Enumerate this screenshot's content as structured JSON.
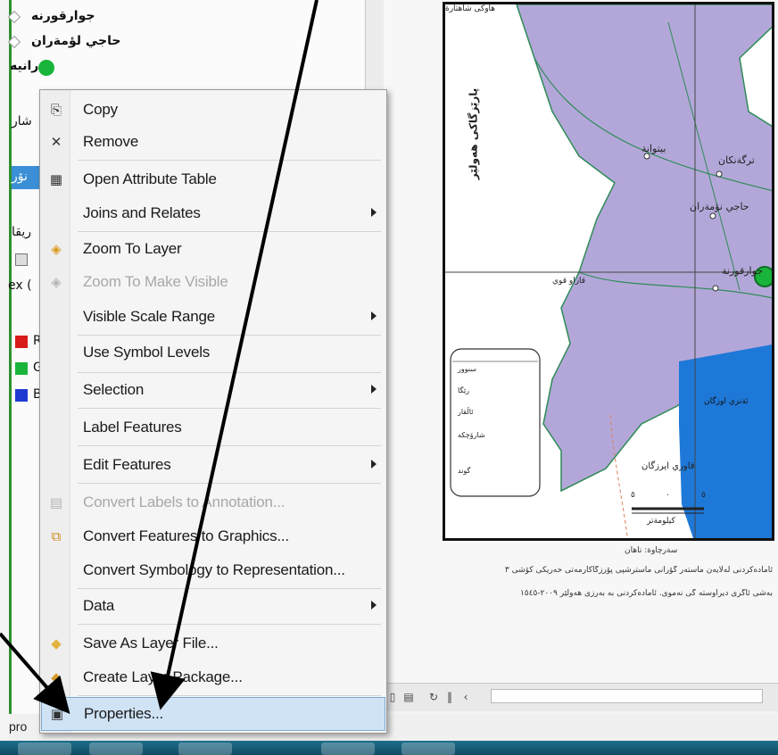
{
  "toc": {
    "layers": [
      {
        "label": "جوارقورنه"
      },
      {
        "label": "حاجي لؤمةران"
      },
      {
        "label": "رانيه"
      }
    ],
    "partial_labels": [
      "شار",
      "نۆر",
      "ريقا",
      "ex (",
      "R",
      "G",
      "B"
    ],
    "band_colors": {
      "R": "#d81b1b",
      "G": "#19b43a",
      "B": "#1f3ad0"
    },
    "highlight_color": "#3b8fd6"
  },
  "map": {
    "polygon_color": "#b3a7d9",
    "water_color": "#1e78d8",
    "place_labels": [
      {
        "text": "بيتوانة"
      },
      {
        "text": "ترگةنكان"
      },
      {
        "text": "حاجي نؤمةران"
      },
      {
        "text": "جوارقورنة"
      },
      {
        "text": "قازاو قوي"
      },
      {
        "text": "ئةنزي اوزگان"
      },
      {
        "text": "قاوري ايرزگان"
      }
    ],
    "vertical_title": "پارێزگاکی هەولێر",
    "top_label": "هاوکی شاهتارة",
    "scale_values": [
      "٥",
      "٠",
      "٥"
    ],
    "scale_unit": "كيلومةتر",
    "legend_items": [
      "سنوور",
      "رێگا",
      "ئاڵقار",
      "شارۆچکە",
      "گوند"
    ],
    "notes": [
      "سةرچاوة: تاهان",
      "ئامادەکردنی لەلایەن ماستەر گۆرانی ماسترشپی پۆرزگاکارمەتی خەریکی کۆشی ١٥٣ -",
      "بەشی ئاگری دیراوستە گی نەموی. ئامادەکردنی بە بەرزی هەولێر ٢٠٠٩-١٥٤٥ "
    ]
  },
  "context_menu": {
    "items": [
      {
        "label": "Copy",
        "icon": "copy-icon",
        "glyph": "⎘",
        "submenu": false,
        "disabled": false
      },
      {
        "label": "Remove",
        "icon": "remove-icon",
        "glyph": "✕",
        "submenu": false,
        "disabled": false
      },
      {
        "label": "Open Attribute Table",
        "icon": "table-icon",
        "glyph": "▦",
        "submenu": false,
        "disabled": false
      },
      {
        "label": "Joins and Relates",
        "icon": "",
        "glyph": "",
        "submenu": true,
        "disabled": false
      },
      {
        "label": "Zoom To Layer",
        "icon": "zoom-layer-icon",
        "glyph": "◈",
        "submenu": false,
        "disabled": false
      },
      {
        "label": "Zoom To Make Visible",
        "icon": "zoom-visible-icon",
        "glyph": "◈",
        "submenu": false,
        "disabled": true
      },
      {
        "label": "Visible Scale Range",
        "icon": "",
        "glyph": "",
        "submenu": true,
        "disabled": false
      },
      {
        "label": "Use Symbol Levels",
        "icon": "",
        "glyph": "",
        "submenu": false,
        "disabled": false
      },
      {
        "label": "Selection",
        "icon": "",
        "glyph": "",
        "submenu": true,
        "disabled": false
      },
      {
        "label": "Label Features",
        "icon": "",
        "glyph": "",
        "submenu": false,
        "disabled": false
      },
      {
        "label": "Edit Features",
        "icon": "",
        "glyph": "",
        "submenu": true,
        "disabled": false
      },
      {
        "label": "Convert Labels to Annotation...",
        "icon": "convert-labels-icon",
        "glyph": "▤",
        "submenu": false,
        "disabled": true
      },
      {
        "label": "Convert Features to Graphics...",
        "icon": "convert-graphics-icon",
        "glyph": "⧉",
        "submenu": false,
        "disabled": false
      },
      {
        "label": "Convert Symbology to Representation...",
        "icon": "",
        "glyph": "",
        "submenu": false,
        "disabled": false
      },
      {
        "label": "Data",
        "icon": "",
        "glyph": "",
        "submenu": true,
        "disabled": false
      },
      {
        "label": "Save As Layer File...",
        "icon": "layer-file-icon",
        "glyph": "◆",
        "submenu": false,
        "disabled": false
      },
      {
        "label": "Create Layer Package...",
        "icon": "layer-package-icon",
        "glyph": "◆",
        "submenu": false,
        "disabled": false
      },
      {
        "label": "Properties...",
        "icon": "properties-icon",
        "glyph": "▣",
        "submenu": false,
        "disabled": false
      }
    ],
    "selected": "Properties...",
    "selection_color": "#cfe3f5"
  },
  "status_bar": {
    "text": "pro"
  },
  "annotation_color": "#000000"
}
